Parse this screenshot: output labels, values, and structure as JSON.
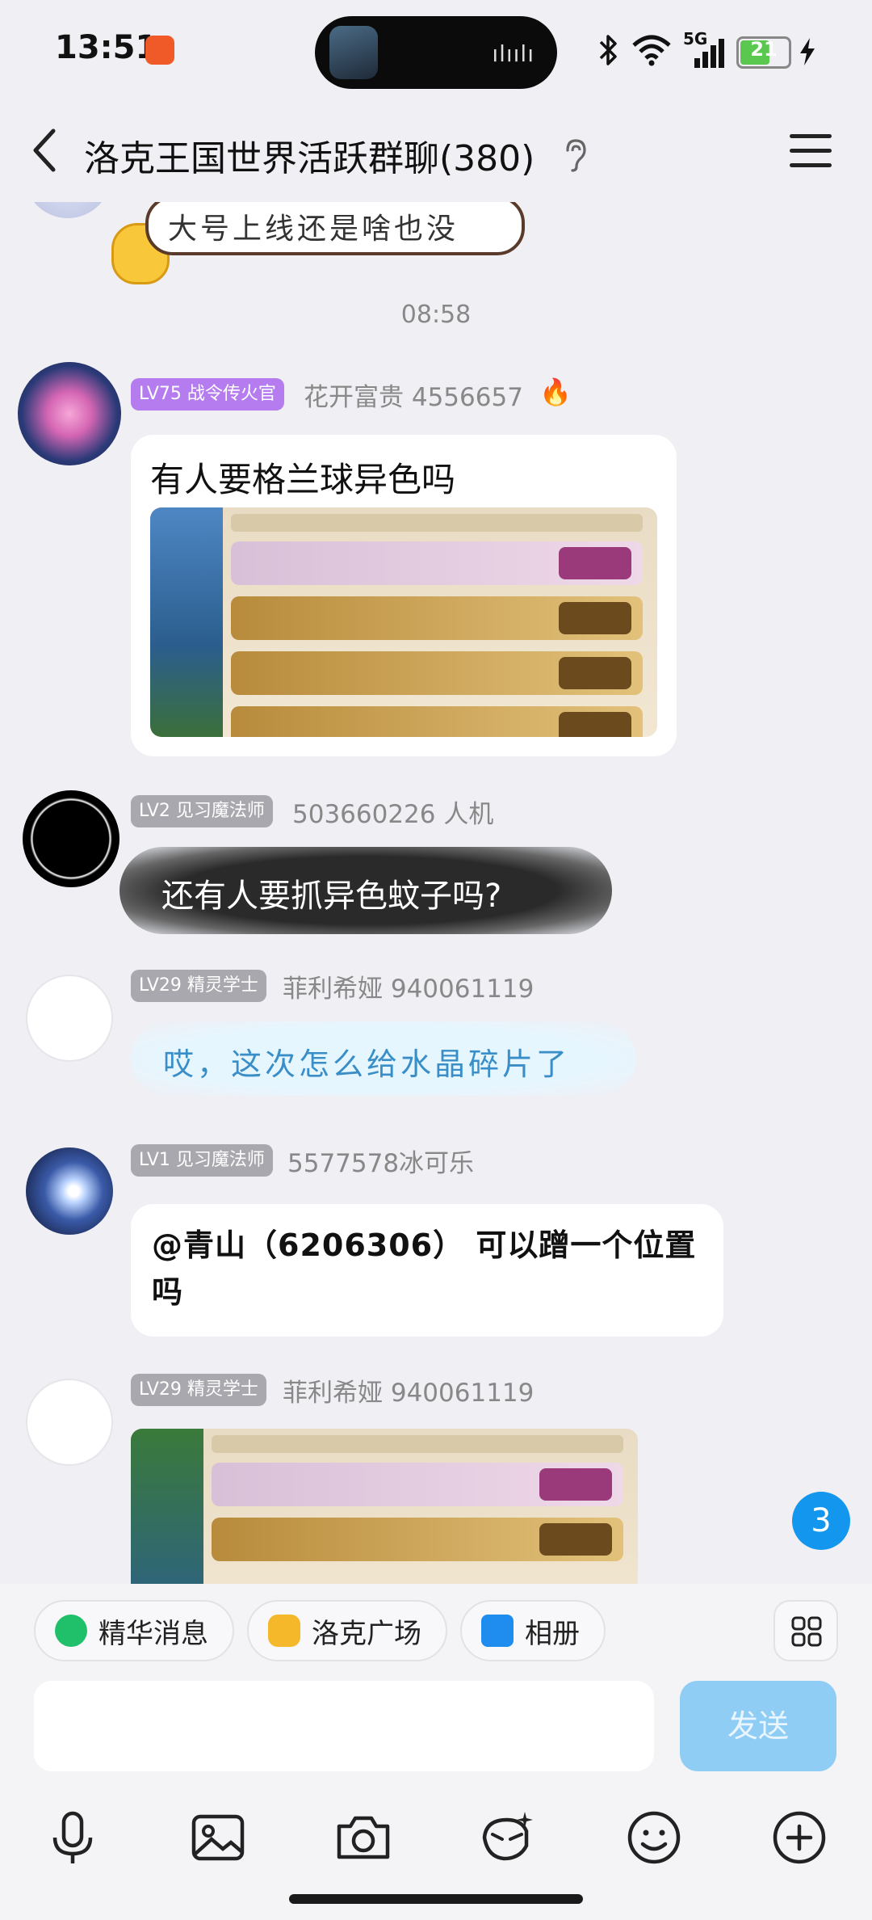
{
  "status_bar": {
    "time": "13:51",
    "network": "5G",
    "battery": "21",
    "wave": "ılıılı"
  },
  "header": {
    "title": "洛克王国世界活跃群聊(380)"
  },
  "messages": [
    {
      "text": "大号上线还是啥也没"
    },
    {
      "time": "08:58"
    },
    {
      "badge": "LV75 战令传火官",
      "badge_color": "#b57cf0",
      "sender": "花开富贵 4556657",
      "text": "有人要格兰球异色吗"
    },
    {
      "badge": "LV2 见习魔法师",
      "badge_color": "#a8a8ae",
      "sender": "503660226 人机",
      "text": "还有人要抓异色蚊子吗?"
    },
    {
      "badge": "LV29 精灵学士",
      "badge_color": "#a8a8ae",
      "sender": "菲利希娅  940061119",
      "text": "哎，这次怎么给水晶碎片了"
    },
    {
      "badge": "LV1 见习魔法师",
      "badge_color": "#a8a8ae",
      "sender": "5577578冰可乐",
      "text": "@青山（6206306） 可以蹭一个位置吗"
    },
    {
      "badge": "LV29 精灵学士",
      "badge_color": "#a8a8ae",
      "sender": "菲利希娅  940061119"
    }
  ],
  "unread_count": "3",
  "quick_chips": [
    {
      "label": "精华消息",
      "icon": "star-icon",
      "color": "#20c06a"
    },
    {
      "label": "洛克广场",
      "icon": "duck-icon",
      "color": "#f5b82a"
    },
    {
      "label": "相册",
      "icon": "album-icon",
      "color": "#1f8cf0"
    }
  ],
  "input": {
    "placeholder": "",
    "send_label": "发送"
  },
  "accent": "#1296ee"
}
